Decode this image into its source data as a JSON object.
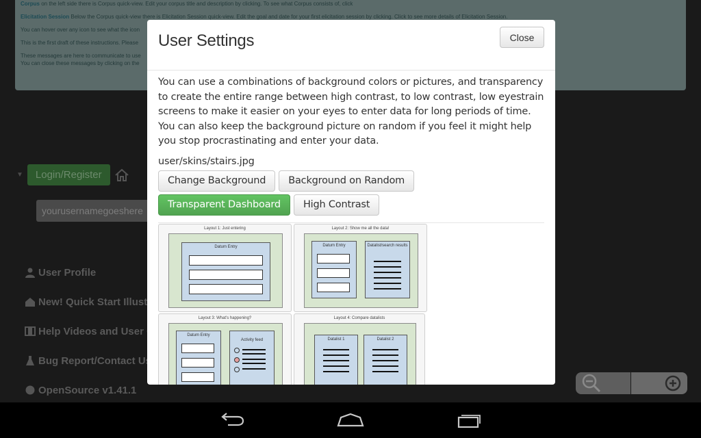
{
  "background": {
    "notice_lines": [
      {
        "bold": "Corpus",
        "text": " on the left side there is Corpus quick-view. Edit your corpus title and description by clicking. To see what Corpus consists of, click"
      },
      {
        "bold": "Elicitation Session",
        "text": " Below the Corpus quick-view there is Elicitation Session quick-view. Edit the goal and date for your first elicitation session by clicking. Click to see more details of Elicitation Session."
      },
      {
        "bold": "",
        "text": "You can hover over any icon to see what the icon"
      },
      {
        "bold": "",
        "text": "This is the first draft of these instructions. Please"
      },
      {
        "bold": "",
        "text": "These messages are here to communicate to use"
      },
      {
        "bold": "",
        "text": "You can close these messages by clicking on the"
      }
    ],
    "login_button": "Login/Register",
    "username_value": "yourusernamegoeshere",
    "menu": [
      {
        "icon": "user-icon",
        "label": "User Profile"
      },
      {
        "icon": "home-icon",
        "label": "New! Quick Start Illustra"
      },
      {
        "icon": "film-icon",
        "label": "Help Videos and User G"
      },
      {
        "icon": "beaker-icon",
        "label": "Bug Report/Contact Us"
      },
      {
        "icon": "github-icon",
        "label": "OpenSource v1.41.1"
      }
    ],
    "zoom_out_icon": "zoom-out-icon",
    "zoom_in_icon": "zoom-in-icon"
  },
  "modal": {
    "title": "User Settings",
    "close_label": "Close",
    "description": "You can use a combinations of background colors or pictures, and transparency to create the entire range between high contrast, to low contrast, low eyestrain screens to make it easier on your eyes to enter data for long periods of time. You can also keep the background picture on random if you feel it might help you stop procrastinating and enter your data.",
    "skin_path": "user/skins/stairs.jpg",
    "buttons": {
      "change_background": "Change Background",
      "background_random": "Background on Random",
      "transparent_dashboard": "Transparent Dashboard",
      "high_contrast": "High Contrast"
    },
    "layouts": [
      {
        "caption": "Layout 1: Just entering",
        "box_label": "Datum Entry"
      },
      {
        "caption": "Layout 2: Show me all the data!",
        "box_label": "Datum Entry",
        "box2_label": "Datalist/search results"
      },
      {
        "caption": "Layout 3: What's happening?",
        "box_label": "Datum Entry",
        "box2_label": "Activity feed"
      },
      {
        "caption": "Layout 4: Compare datalists",
        "box_label": "Datalist 1",
        "box2_label": "Datalist 2"
      }
    ]
  },
  "navbar": {
    "back_icon": "back-icon",
    "home_icon": "home-nav-icon",
    "recents_icon": "recent-apps-icon"
  },
  "colors": {
    "accent_green": "#5bb75b",
    "backdrop": "#0b0b0b",
    "modal_bg": "#ffffff"
  }
}
